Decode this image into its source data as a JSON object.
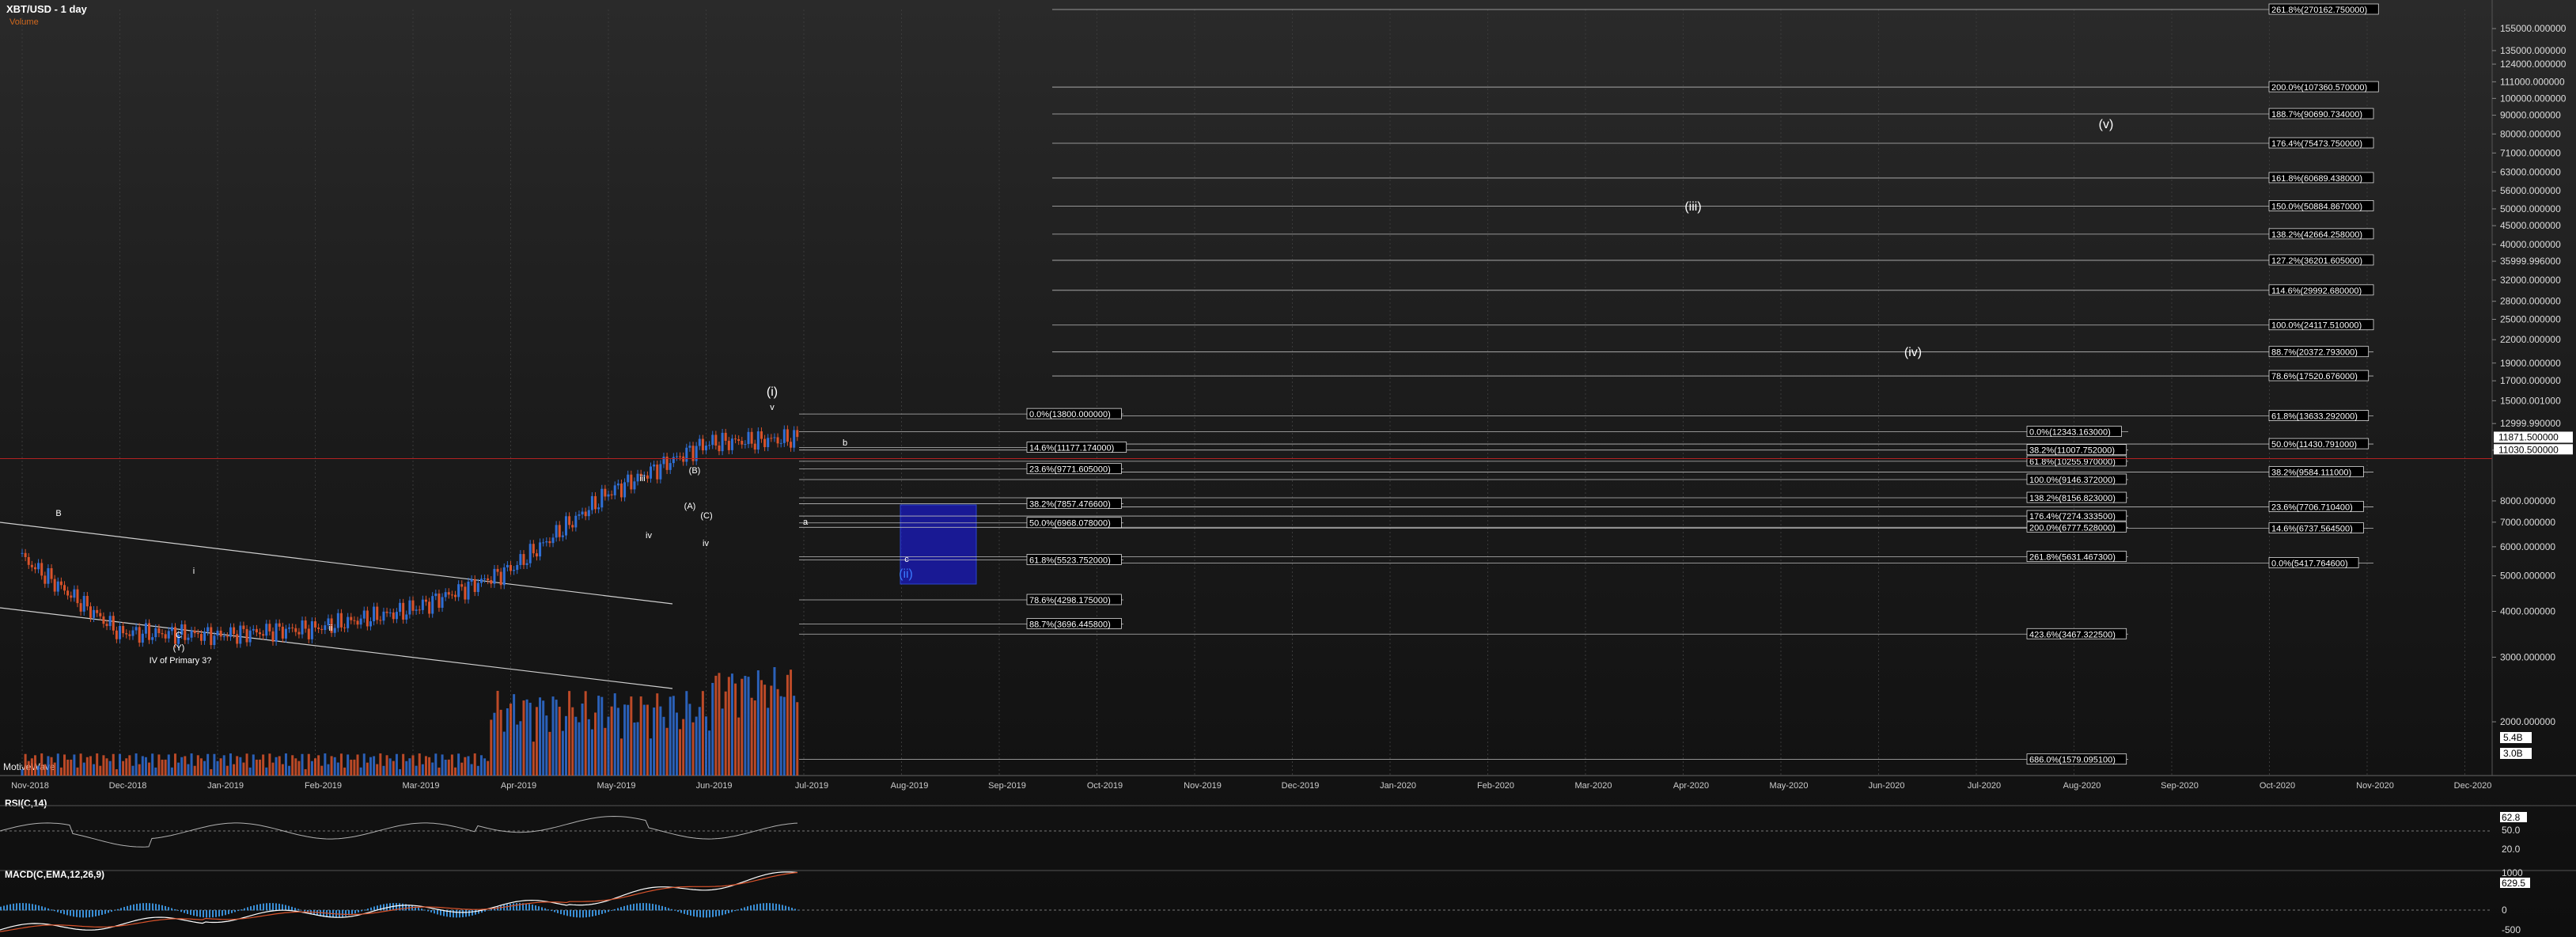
{
  "header": {
    "title": "XBT/USD - 1 day",
    "volume_label": "Volume"
  },
  "brand": "MotiveWave",
  "colors": {
    "up": "#2f6fd6",
    "down": "#d9532b",
    "fib_box": "#1a1ab4",
    "price_line": "#b22222",
    "rsi_line": "#b0b0b0",
    "macd_line": "#ffffff",
    "signal_line": "#d9532b"
  },
  "chart_data": [
    {
      "type": "candlestick",
      "title": "XBT/USD - 1 day",
      "yscale": "log",
      "ylim": [
        1500,
        180000
      ],
      "current_price": "11871.500000",
      "price_tags": [
        "11030.500000"
      ],
      "y_ticks": [
        "155000.000000",
        "135000.000000",
        "124000.000000",
        "111000.000000",
        "100000.000000",
        "90000.000000",
        "80000.000000",
        "71000.000000",
        "63000.000000",
        "56000.000000",
        "50000.000000",
        "45000.000000",
        "40000.000000",
        "35999.996000",
        "32000.000000",
        "28000.000000",
        "25000.000000",
        "22000.000000",
        "19000.000000",
        "17000.000000",
        "15000.001000",
        "12999.990000",
        "11000.000000",
        "8000.000000",
        "7000.000000",
        "6000.000000",
        "5000.000000",
        "4000.000000",
        "3000.000000",
        "2000.000000"
      ],
      "x_ticks": [
        "Nov-2018",
        "Dec-2018",
        "Jan-2019",
        "Feb-2019",
        "Mar-2019",
        "Apr-2019",
        "May-2019",
        "Jun-2019",
        "Jul-2019",
        "Aug-2019",
        "Sep-2019",
        "Oct-2019",
        "Nov-2019",
        "Dec-2019",
        "Jan-2020",
        "Feb-2020",
        "Mar-2020",
        "Apr-2020",
        "May-2020",
        "Jun-2020",
        "Jul-2020",
        "Aug-2020",
        "Sep-2020",
        "Oct-2020",
        "Nov-2020",
        "Dec-2020"
      ],
      "monthly_closes": [
        {
          "date": "2018-11",
          "value": 5600
        },
        {
          "date": "2018-12",
          "value": 3500
        },
        {
          "date": "2019-01",
          "value": 3450
        },
        {
          "date": "2019-02",
          "value": 3600
        },
        {
          "date": "2019-03",
          "value": 4050
        },
        {
          "date": "2019-04",
          "value": 5200
        },
        {
          "date": "2019-05",
          "value": 8400
        },
        {
          "date": "2019-06",
          "value": 11500
        },
        {
          "date": "2019-07",
          "value": 11871.5
        }
      ],
      "wave_labels": [
        "B",
        "i",
        "C",
        "(Y)",
        "IV of Primary 3?",
        "ii",
        "iii",
        "iv",
        "(A)",
        "(B)",
        "(C)",
        "iv",
        "(i)",
        "v",
        "b",
        "a",
        "(ii)",
        "c",
        "(iii)",
        "(iv)",
        "(v)"
      ],
      "fib_labels_right": [
        "261.8%(270162.750000)",
        "200.0%(107360.570000)",
        "188.7%(90690.734000)",
        "176.4%(75473.750000)",
        "161.8%(60689.438000)",
        "150.0%(50884.867000)",
        "138.2%(42664.258000)",
        "127.2%(36201.605000)",
        "114.6%(29992.680000)",
        "100.0%(24117.510000)",
        "88.7%(20372.793000)",
        "78.6%(17520.676000)",
        "61.8%(13633.292000)",
        "50.0%(11430.791000)",
        "38.2%(9584.111000)",
        "23.6%(7706.710400)",
        "14.6%(6737.564500)",
        "0.0%(5417.764600)"
      ],
      "fib_labels_mid": [
        "0.0%(12343.163000)",
        "38.2%(11007.752000)",
        "61.8%(10255.970000)",
        "100.0%(9146.372000)",
        "138.2%(8156.823000)",
        "176.4%(7274.333500)",
        "200.0%(6777.528000)",
        "261.8%(5631.467300)",
        "423.6%(3467.322500)",
        "686.0%(1579.095100)"
      ],
      "fib_labels_left": [
        "0.0%(13800.000000)",
        "14.6%(11177.174000)",
        "23.6%(9771.605000)",
        "38.2%(7857.476600)",
        "50.0%(6968.078000)",
        "61.8%(5523.752000)",
        "78.6%(4298.175000)",
        "88.7%(3696.445800)"
      ],
      "volume_tags": [
        "5.4B",
        "3.0B"
      ]
    },
    {
      "type": "line",
      "title": "RSI(C,14)",
      "ylim": [
        0,
        100
      ],
      "y_ticks": [
        "62.8",
        "50.0",
        "20.0"
      ]
    },
    {
      "type": "line",
      "title": "MACD(C,EMA,12,26,9)",
      "y_ticks": [
        "1000",
        "629.5",
        "0",
        "-500"
      ]
    }
  ]
}
